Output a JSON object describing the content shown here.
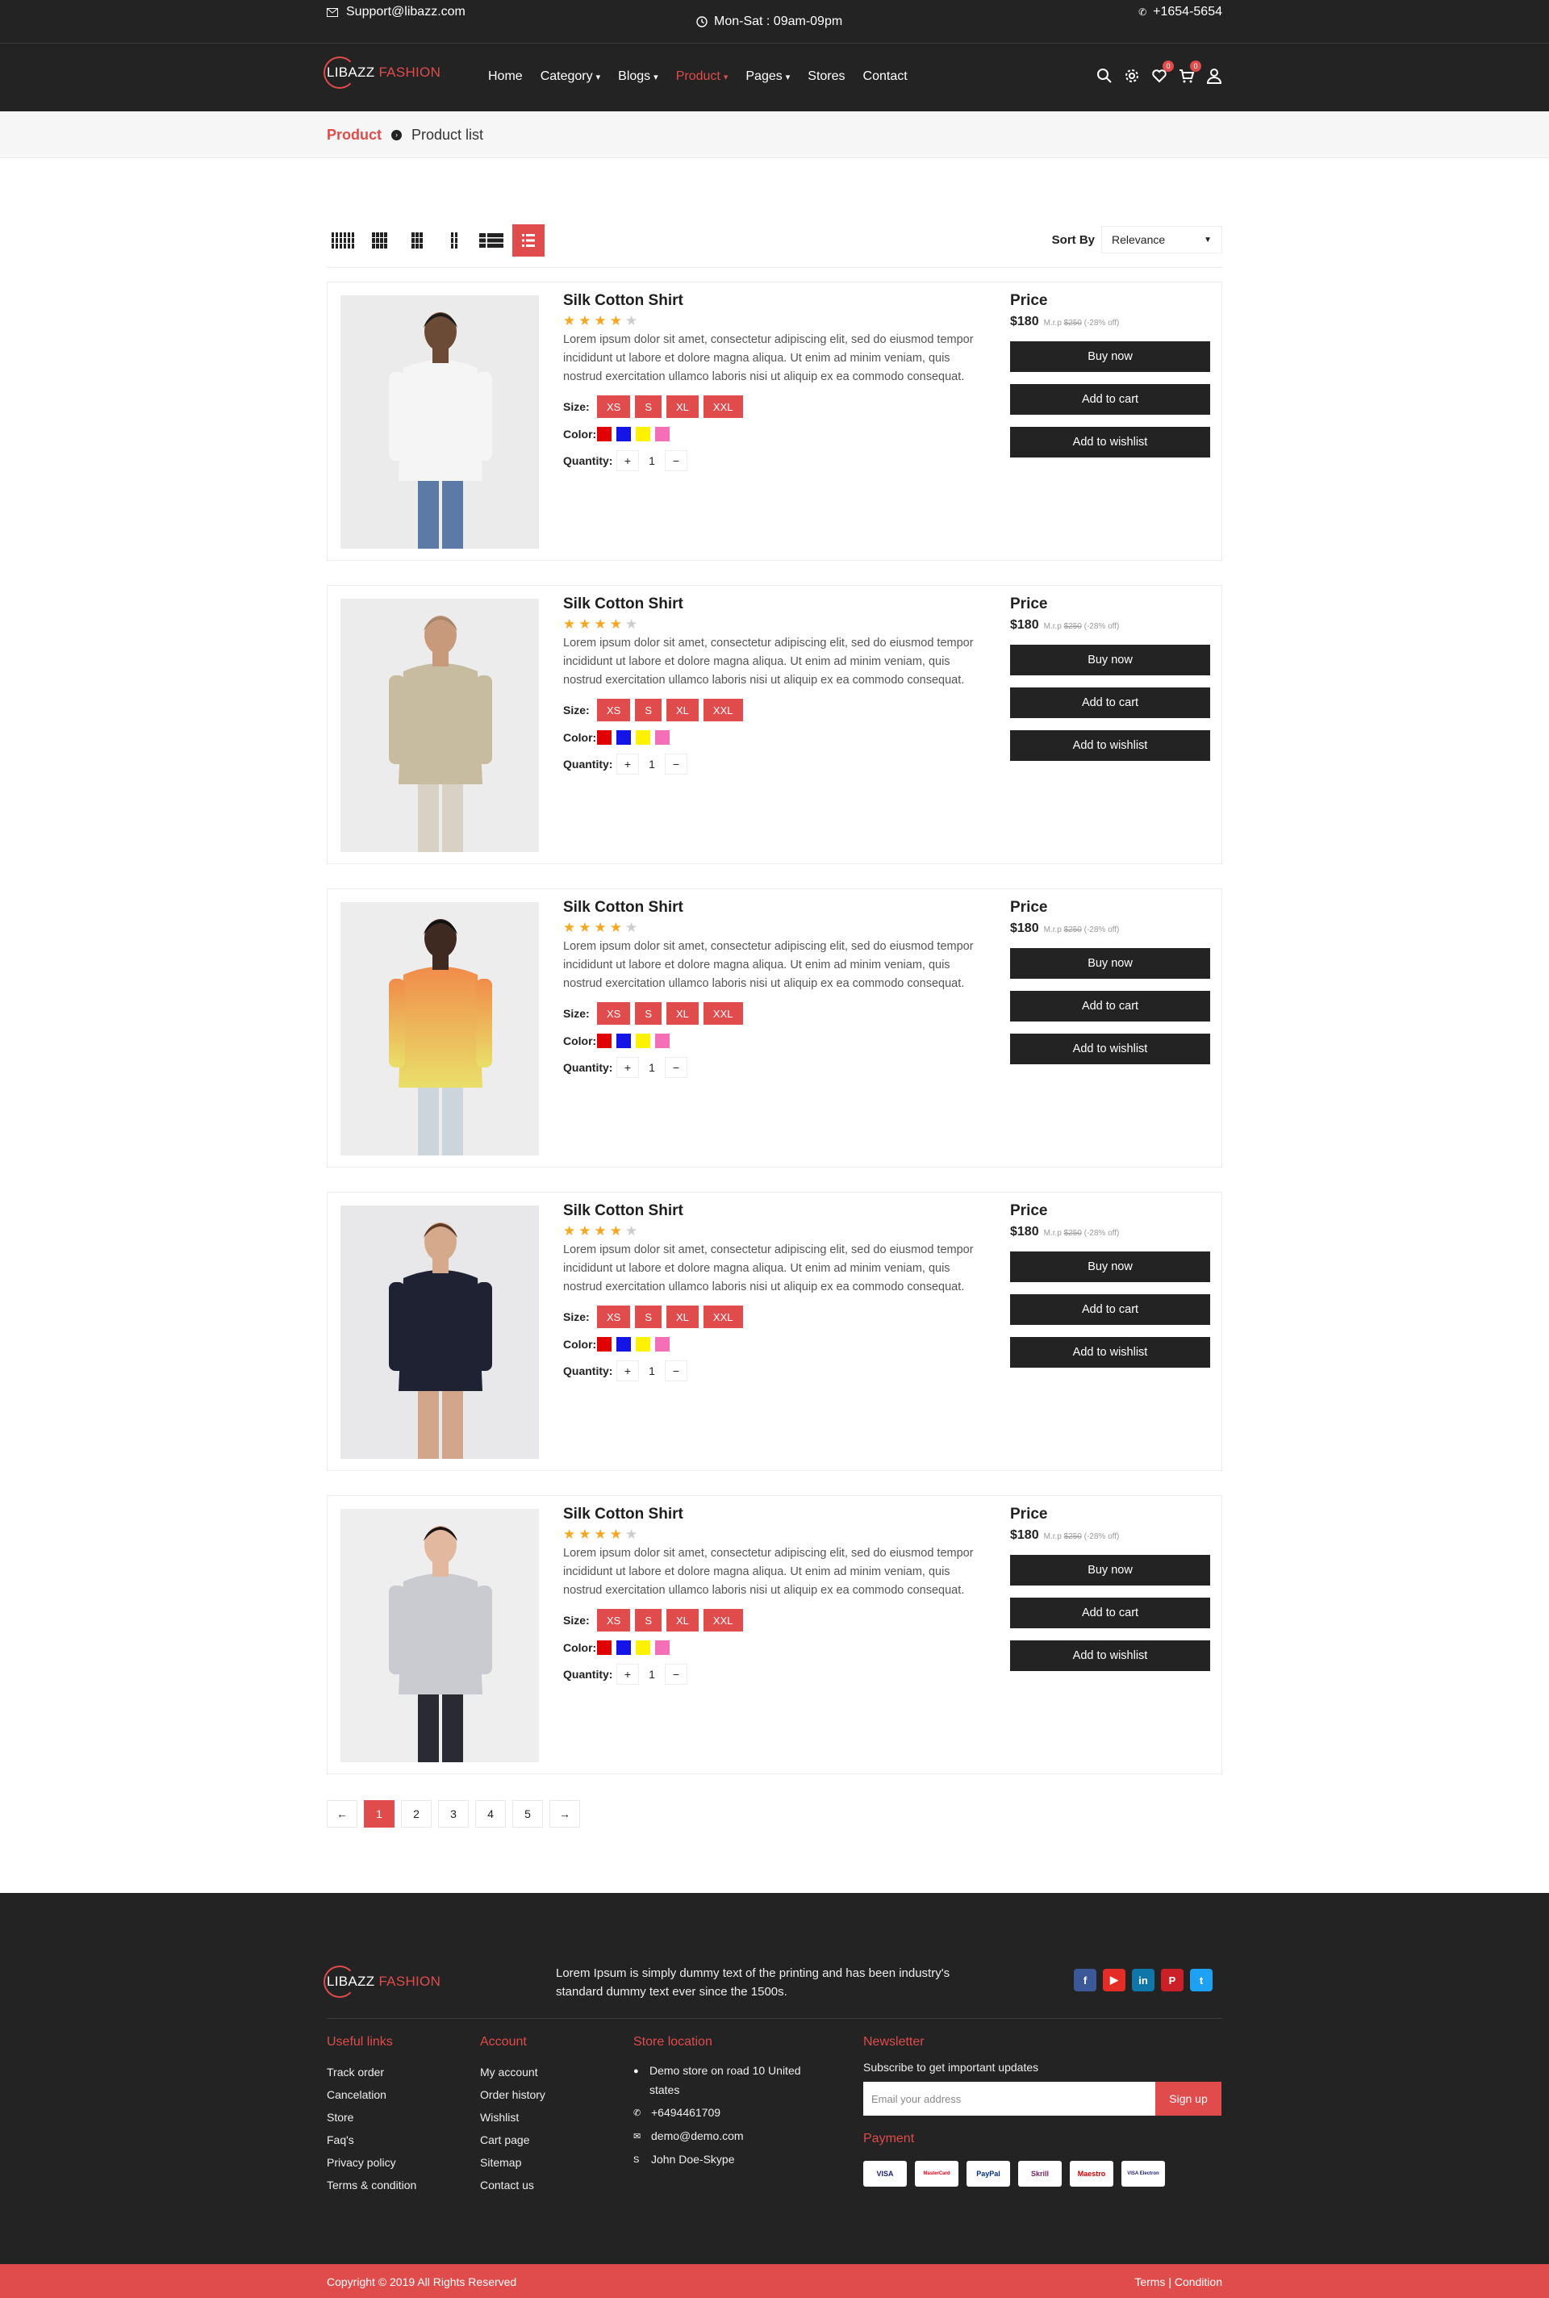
{
  "topbar": {
    "email": "Support@libazz.com",
    "hours": "Mon-Sat : 09am-09pm",
    "phone": "+1654-5654"
  },
  "brand": {
    "name": "LIBAZZ",
    "accent": "FASHION",
    "accent_color": "#e04b4b"
  },
  "nav": {
    "items": [
      {
        "label": "Home",
        "caret": ""
      },
      {
        "label": "Category",
        "caret": "▾"
      },
      {
        "label": "Blogs",
        "caret": "▾"
      },
      {
        "label": "Product",
        "caret": "▾"
      },
      {
        "label": "Pages",
        "caret": "▾"
      },
      {
        "label": "Stores",
        "caret": ""
      },
      {
        "label": "Contact",
        "caret": ""
      }
    ],
    "active": "Product",
    "wishlist_count": "0",
    "cart_count": "0"
  },
  "breadcrumb": {
    "main": "Product",
    "sub": "Product list"
  },
  "toolbar": {
    "sort_label": "Sort By",
    "sort_value": "Relevance"
  },
  "products": [
    {
      "name": "Silk Cotton Shirt",
      "rating": 4,
      "image": "man-white-shirt"
    },
    {
      "name": "Silk Cotton Shirt",
      "rating": 4,
      "image": "man-beige-jacket-sunglasses"
    },
    {
      "name": "Silk Cotton Shirt",
      "rating": 4,
      "image": "man-orange-tie-dye-shirt"
    },
    {
      "name": "Silk Cotton Shirt",
      "rating": 4,
      "image": "woman-navy-dress"
    },
    {
      "name": "Silk Cotton Shirt",
      "rating": 4,
      "image": "woman-printed-top"
    }
  ],
  "product_common": {
    "description": "Lorem ipsum dolor sit amet, consectetur adipiscing elit, sed do eiusmod tempor incididunt ut labore et dolore magna aliqua. Ut enim ad minim veniam, quis nostrud exercitation ullamco laboris nisi ut aliquip ex ea commodo consequat.",
    "size_label": "Size:",
    "sizes": [
      "XS",
      "S",
      "XL",
      "XXL"
    ],
    "color_label": "Color:",
    "colors": [
      "#e10000",
      "#1414e6",
      "#fff200",
      "#f46fb5"
    ],
    "quantity_label": "Quantity:",
    "quantity": "1",
    "price_heading": "Price",
    "price": "$180",
    "mrp_label": "M.r.p",
    "mrp": "$250",
    "discount": "(-28% off)",
    "buy_label": "Buy now",
    "cart_label": "Add to cart",
    "wishlist_label": "Add to wishlist"
  },
  "pagination": {
    "prev": "←",
    "pages": [
      "1",
      "2",
      "3",
      "4",
      "5"
    ],
    "current": "1",
    "next": "→"
  },
  "footer": {
    "about": "Lorem Ipsum is simply dummy text of the printing and has been industry's standard dummy text ever since the 1500s.",
    "useful_title": "Useful links",
    "useful": [
      "Track order",
      "Cancelation",
      "Store",
      "Faq's",
      "Privacy policy",
      "Terms & condition"
    ],
    "account_title": "Account",
    "account": [
      "My account",
      "Order history",
      "Wishlist",
      "Cart page",
      "Sitemap",
      "Contact us"
    ],
    "store_title": "Store location",
    "address": "Demo store on road 10 United states",
    "phone": "+6494461709",
    "email": "demo@demo.com",
    "skype": "John Doe-Skype",
    "newsletter_title": "Newsletter",
    "newsletter_sub": "Subscribe to get important updates",
    "email_placeholder": "Email your address",
    "signup": "Sign up",
    "payment_title": "Payment",
    "payments": [
      "VISA",
      "MasterCard",
      "PayPal",
      "Skrill",
      "Maestro",
      "VISA Electron"
    ],
    "copyright": "Copyright © 2019 All Rights Reserved",
    "terms": "Terms | Condition"
  }
}
